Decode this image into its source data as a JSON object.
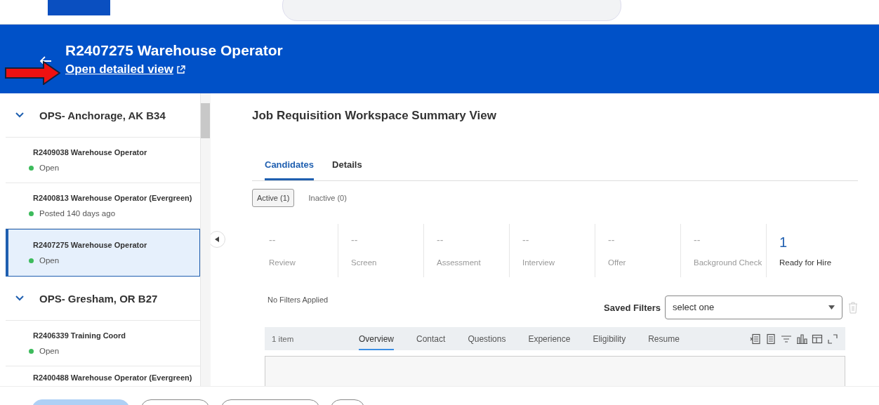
{
  "header": {
    "title": "R2407275 Warehouse Operator",
    "link": "Open detailed view"
  },
  "sidebar": {
    "groups": [
      {
        "name": "OPS- Anchorage, AK B34",
        "expanded": true,
        "items": [
          {
            "title": "R2409038 Warehouse Operator",
            "status": "Open",
            "color": "#3dbb5c",
            "selected": false
          },
          {
            "title": "R2400813 Warehouse Operator (Evergreen)",
            "status": "Posted 140 days ago",
            "color": "#3dbb5c",
            "selected": false
          },
          {
            "title": "R2407275 Warehouse Operator",
            "status": "Open",
            "color": "#3dbb5c",
            "selected": true
          }
        ]
      },
      {
        "name": "OPS- Gresham, OR B27",
        "expanded": true,
        "items": [
          {
            "title": "R2406339 Training Coord",
            "status": "Open",
            "color": "#3dbb5c",
            "selected": false
          },
          {
            "title": "R2400488 Warehouse Operator (Evergreen)",
            "selected": false
          }
        ]
      }
    ]
  },
  "main": {
    "title": "Job Requisition Workspace Summary View",
    "tabs": [
      {
        "label": "Candidates",
        "selected": true
      },
      {
        "label": "Details",
        "selected": false
      }
    ],
    "toggles": [
      {
        "label": "Active (1)",
        "selected": true
      },
      {
        "label": "Inactive (0)",
        "selected": false
      }
    ],
    "stages": [
      {
        "count": "--",
        "label": "Review",
        "active": false
      },
      {
        "count": "--",
        "label": "Screen",
        "active": false
      },
      {
        "count": "--",
        "label": "Assessment",
        "active": false
      },
      {
        "count": "--",
        "label": "Interview",
        "active": false
      },
      {
        "count": "--",
        "label": "Offer",
        "active": false
      },
      {
        "count": "--",
        "label": "Background Check",
        "active": false
      },
      {
        "count": "1",
        "label": "Ready for Hire",
        "active": true
      }
    ],
    "filters_note": "No Filters Applied",
    "saved_filters": {
      "label": "Saved Filters",
      "placeholder": "select one"
    },
    "grid": {
      "count": "1 item",
      "tabs": [
        {
          "label": "Overview",
          "selected": true
        },
        {
          "label": "Contact",
          "selected": false
        },
        {
          "label": "Questions",
          "selected": false
        },
        {
          "label": "Experience",
          "selected": false
        },
        {
          "label": "Eligibility",
          "selected": false
        },
        {
          "label": "Resume",
          "selected": false
        }
      ]
    }
  }
}
